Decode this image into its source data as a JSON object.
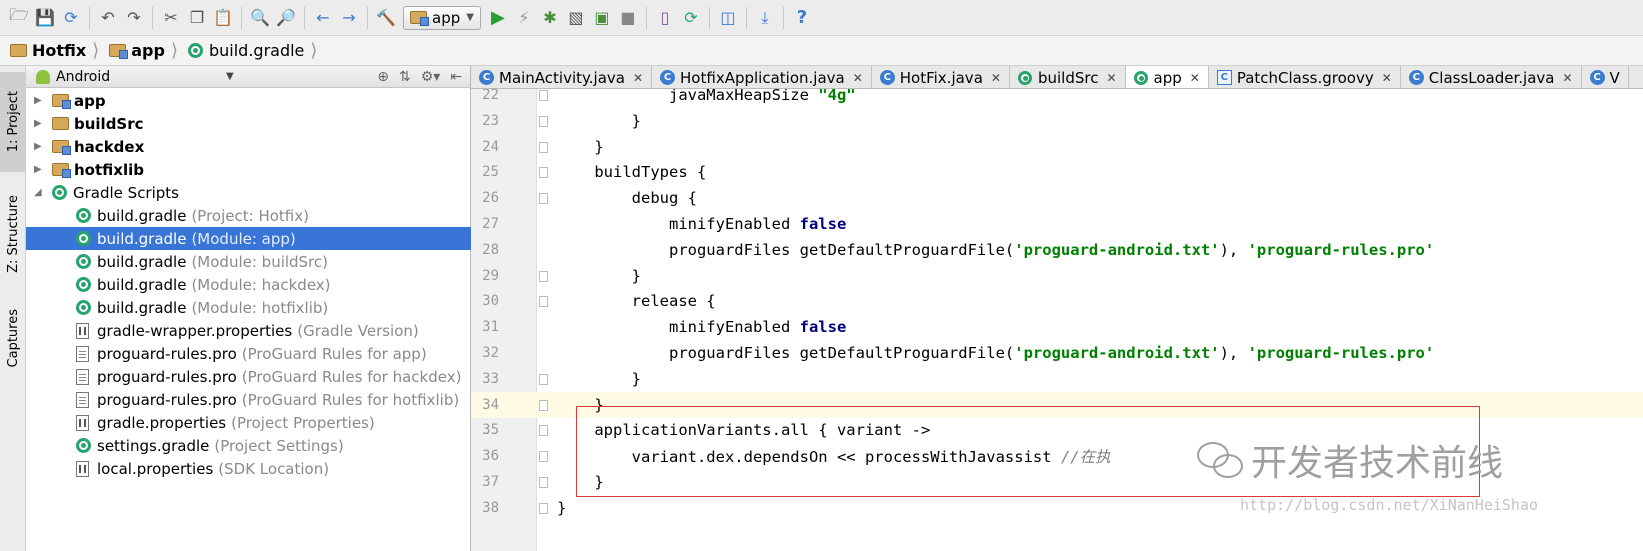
{
  "toolbar": {
    "run_config": "app",
    "icons": [
      "open-folder-icon",
      "save-icon",
      "sync-icon",
      "undo-icon",
      "redo-icon",
      "cut-icon",
      "copy-icon",
      "paste-icon",
      "find-icon",
      "replace-icon",
      "back-icon",
      "forward-icon",
      "make-icon",
      "run-icon",
      "apply-changes-icon",
      "debug-icon",
      "profile-icon",
      "attach-debugger-icon",
      "stop-icon",
      "avd-manager-icon",
      "sync-gradle-icon",
      "project-structure-icon",
      "sdk-manager-icon",
      "help-icon"
    ]
  },
  "breadcrumb": {
    "items": [
      "Hotfix",
      "app",
      "build.gradle"
    ]
  },
  "left_strip": {
    "tabs": [
      "1: Project",
      "Z: Structure",
      "Captures"
    ]
  },
  "project_panel": {
    "view_selector": "Android",
    "tree": [
      {
        "name": "app",
        "hint": "",
        "type": "module",
        "bold": true,
        "expander": "collapsed"
      },
      {
        "name": "buildSrc",
        "hint": "",
        "type": "folder",
        "bold": true,
        "expander": "collapsed"
      },
      {
        "name": "hackdex",
        "hint": "",
        "type": "module",
        "bold": true,
        "expander": "collapsed"
      },
      {
        "name": "hotfixlib",
        "hint": "",
        "type": "module",
        "bold": true,
        "expander": "collapsed"
      },
      {
        "name": "Gradle Scripts",
        "hint": "",
        "type": "gradle",
        "bold": false,
        "expander": "expanded"
      },
      {
        "name": "build.gradle",
        "hint": "(Project: Hotfix)",
        "type": "gradle",
        "bold": false,
        "expander": ""
      },
      {
        "name": "build.gradle",
        "hint": "(Module: app)",
        "type": "gradle",
        "bold": false,
        "expander": "",
        "selected": true
      },
      {
        "name": "build.gradle",
        "hint": "(Module: buildSrc)",
        "type": "gradle",
        "bold": false,
        "expander": ""
      },
      {
        "name": "build.gradle",
        "hint": "(Module: hackdex)",
        "type": "gradle",
        "bold": false,
        "expander": ""
      },
      {
        "name": "build.gradle",
        "hint": "(Module: hotfixlib)",
        "type": "gradle",
        "bold": false,
        "expander": ""
      },
      {
        "name": "gradle-wrapper.properties",
        "hint": "(Gradle Version)",
        "type": "props",
        "bold": false,
        "expander": ""
      },
      {
        "name": "proguard-rules.pro",
        "hint": "(ProGuard Rules for app)",
        "type": "file",
        "bold": false,
        "expander": ""
      },
      {
        "name": "proguard-rules.pro",
        "hint": "(ProGuard Rules for hackdex)",
        "type": "file",
        "bold": false,
        "expander": ""
      },
      {
        "name": "proguard-rules.pro",
        "hint": "(ProGuard Rules for hotfixlib)",
        "type": "file",
        "bold": false,
        "expander": ""
      },
      {
        "name": "gradle.properties",
        "hint": "(Project Properties)",
        "type": "props",
        "bold": false,
        "expander": ""
      },
      {
        "name": "settings.gradle",
        "hint": "(Project Settings)",
        "type": "gradle",
        "bold": false,
        "expander": ""
      },
      {
        "name": "local.properties",
        "hint": "(SDK Location)",
        "type": "props",
        "bold": false,
        "expander": ""
      }
    ]
  },
  "editor_tabs": [
    {
      "label": "MainActivity.java",
      "icon": "class",
      "active": false
    },
    {
      "label": "HotfixApplication.java",
      "icon": "class",
      "active": false
    },
    {
      "label": "HotFix.java",
      "icon": "class",
      "active": false
    },
    {
      "label": "buildSrc",
      "icon": "gradle",
      "active": false
    },
    {
      "label": "app",
      "icon": "gradle",
      "active": true
    },
    {
      "label": "PatchClass.groovy",
      "icon": "groovy",
      "active": false
    },
    {
      "label": "ClassLoader.java",
      "icon": "class",
      "active": false
    },
    {
      "label": "V",
      "icon": "class",
      "active": false
    }
  ],
  "editor": {
    "lines": [
      {
        "n": "22",
        "segs": [
          [
            "",
            "            "
          ],
          [
            "",
            "javaMaxHeapSize "
          ],
          [
            "str",
            "\"4g\""
          ]
        ]
      },
      {
        "n": "23",
        "segs": [
          [
            "",
            "        }"
          ]
        ]
      },
      {
        "n": "24",
        "segs": [
          [
            "",
            "    }"
          ]
        ]
      },
      {
        "n": "25",
        "segs": [
          [
            "",
            "    buildTypes {"
          ]
        ]
      },
      {
        "n": "26",
        "segs": [
          [
            "",
            "        debug {"
          ]
        ]
      },
      {
        "n": "27",
        "segs": [
          [
            "",
            "            minifyEnabled "
          ],
          [
            "kw",
            "false"
          ]
        ]
      },
      {
        "n": "28",
        "segs": [
          [
            "",
            "            proguardFiles getDefaultProguardFile("
          ],
          [
            "str",
            "'proguard-android.txt'"
          ],
          [
            "",
            "), "
          ],
          [
            "str",
            "'proguard-rules.pro'"
          ]
        ]
      },
      {
        "n": "29",
        "segs": [
          [
            "",
            "        }"
          ]
        ]
      },
      {
        "n": "30",
        "segs": [
          [
            "",
            "        release {"
          ]
        ]
      },
      {
        "n": "31",
        "segs": [
          [
            "",
            "            minifyEnabled "
          ],
          [
            "kw",
            "false"
          ]
        ]
      },
      {
        "n": "32",
        "segs": [
          [
            "",
            "            proguardFiles getDefaultProguardFile("
          ],
          [
            "str",
            "'proguard-android.txt'"
          ],
          [
            "",
            "), "
          ],
          [
            "str",
            "'proguard-rules.pro'"
          ]
        ]
      },
      {
        "n": "33",
        "segs": [
          [
            "",
            "        }"
          ]
        ]
      },
      {
        "n": "34",
        "segs": [
          [
            "",
            "    }"
          ]
        ],
        "caret": true
      },
      {
        "n": "35",
        "segs": [
          [
            "",
            "    applicationVariants.all { variant ->"
          ]
        ]
      },
      {
        "n": "36",
        "segs": [
          [
            "",
            "        variant.dex.dependsOn << processWithJavassist "
          ],
          [
            "cmt",
            "//在执"
          ]
        ]
      },
      {
        "n": "37",
        "segs": [
          [
            "",
            "    }"
          ]
        ]
      },
      {
        "n": "38",
        "segs": [
          [
            "",
            "}"
          ]
        ]
      }
    ]
  },
  "watermark": {
    "text": "开发者技术前线",
    "url": "http://blog.csdn.net/XiNanHeiShao"
  }
}
